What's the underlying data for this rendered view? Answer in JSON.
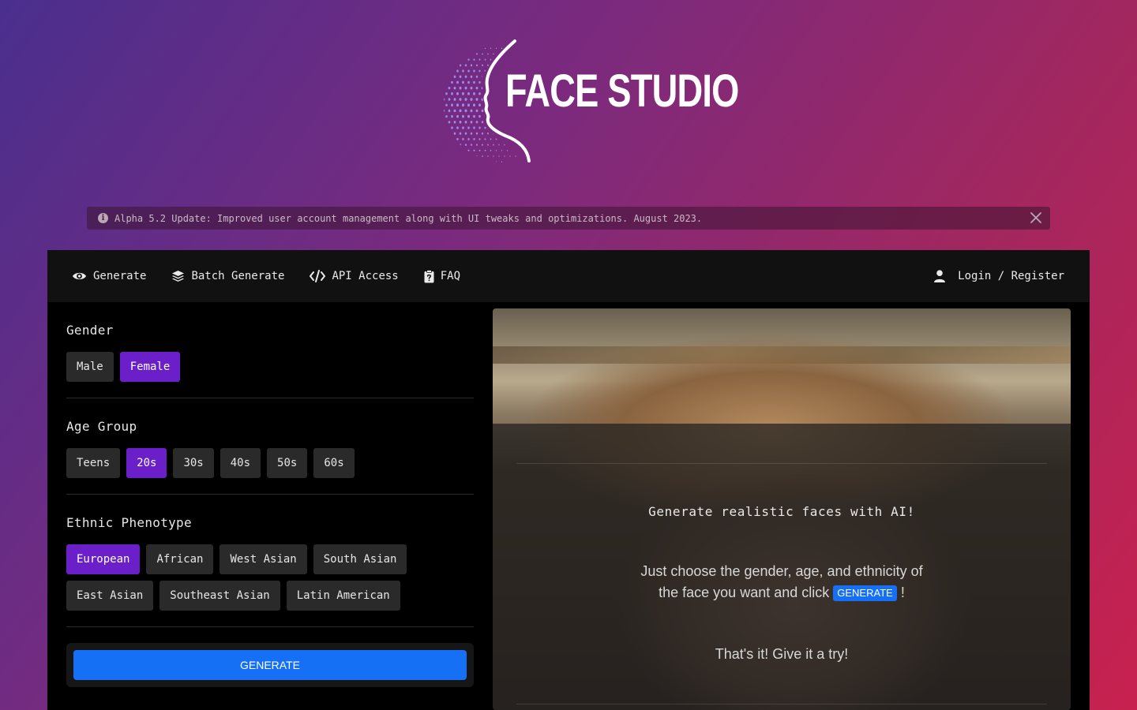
{
  "brand": {
    "name": "FACE STUDIO"
  },
  "alert": {
    "text": "Alpha 5.2 Update: Improved user account management along with UI tweaks and optimizations. August 2023."
  },
  "nav": {
    "items": [
      {
        "label": "Generate",
        "icon": "eye-icon"
      },
      {
        "label": "Batch Generate",
        "icon": "layers-icon"
      },
      {
        "label": "API Access",
        "icon": "code-icon"
      },
      {
        "label": "FAQ",
        "icon": "clipboard-question-icon"
      }
    ],
    "login": {
      "label": "Login / Register",
      "icon": "user-icon"
    }
  },
  "gender": {
    "title": "Gender",
    "options": [
      "Male",
      "Female"
    ],
    "selected": "Female"
  },
  "age": {
    "title": "Age Group",
    "options": [
      "Teens",
      "20s",
      "30s",
      "40s",
      "50s",
      "60s"
    ],
    "selected": "20s"
  },
  "ethnicity": {
    "title": "Ethnic Phenotype",
    "options": [
      "European",
      "African",
      "West Asian",
      "South Asian",
      "East Asian",
      "Southeast Asian",
      "Latin American"
    ],
    "selected": "European"
  },
  "generate_button": "GENERATE",
  "preview": {
    "headline": "Generate realistic faces with AI!",
    "body_before": "Just choose the gender, age, and ethnicity of the face you want and click",
    "badge": "GENERATE",
    "body_after": "!",
    "closing": "That's it! Give it a try!"
  },
  "colors": {
    "accent_purple": "#6a1fc9",
    "primary_blue": "#1670f5",
    "logo_dots": "#9d8cf0"
  }
}
